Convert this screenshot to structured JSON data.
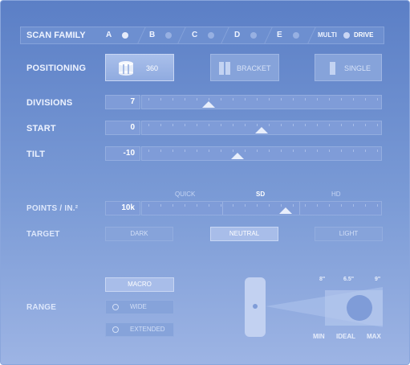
{
  "scan_family": {
    "label": "SCAN FAMILY",
    "tabs": [
      {
        "label": "A",
        "active": true
      },
      {
        "label": "B",
        "active": false
      },
      {
        "label": "C",
        "active": false
      },
      {
        "label": "D",
        "active": false
      },
      {
        "label": "E",
        "active": false
      }
    ],
    "multi_label": "MULTI",
    "drive_label": "DRIVE"
  },
  "positioning": {
    "label": "POSITIONING",
    "options": [
      {
        "label": "360",
        "icon": "cylinder-360-icon",
        "active": true
      },
      {
        "label": "BRACKET",
        "icon": "bracket-icon",
        "active": false
      },
      {
        "label": "SINGLE",
        "icon": "single-panel-icon",
        "active": false
      }
    ]
  },
  "divisions": {
    "label": "DIVISIONS",
    "value": "7",
    "level": 0.28
  },
  "start": {
    "label": "START",
    "value": "0",
    "level": 0.5
  },
  "tilt": {
    "label": "TILT",
    "value": "-10",
    "level": 0.4
  },
  "points": {
    "label": "POINTS / IN.²",
    "value": "10k",
    "level": 0.6,
    "quality_labels": [
      {
        "label": "QUICK",
        "selected": false
      },
      {
        "label": "SD",
        "selected": true
      },
      {
        "label": "HD",
        "selected": false
      }
    ]
  },
  "target": {
    "label": "TARGET",
    "options": [
      {
        "label": "DARK",
        "active": false
      },
      {
        "label": "NEUTRAL",
        "active": true
      },
      {
        "label": "LIGHT",
        "active": false
      }
    ]
  },
  "range": {
    "label": "RANGE",
    "options": [
      {
        "label": "MACRO",
        "active": true
      },
      {
        "label": "WIDE",
        "active": false
      },
      {
        "label": "EXTENDED",
        "active": false
      }
    ],
    "distances": [
      "8\"",
      "6.5\"",
      "9\""
    ],
    "distance_labels": [
      "MIN",
      "IDEAL",
      "MAX"
    ]
  },
  "colors": {
    "background": "#6f91d0",
    "active": "#e6ecfb",
    "inactive": "#86a3da"
  }
}
